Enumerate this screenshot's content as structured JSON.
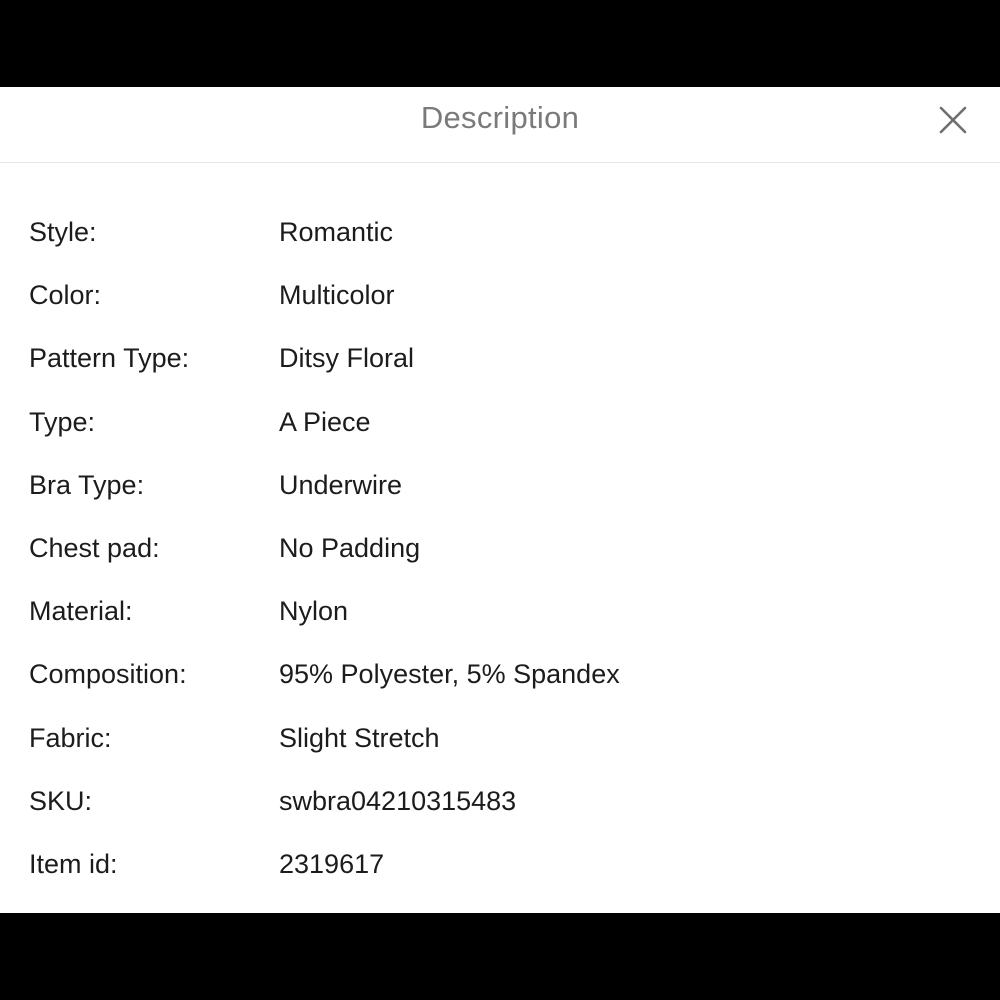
{
  "header": {
    "title": "Description",
    "close_icon": "close-icon"
  },
  "specs": [
    {
      "label": "Style:",
      "value": "Romantic"
    },
    {
      "label": "Color:",
      "value": "Multicolor"
    },
    {
      "label": "Pattern Type:",
      "value": "Ditsy Floral"
    },
    {
      "label": "Type:",
      "value": "A Piece"
    },
    {
      "label": "Bra Type:",
      "value": "Underwire"
    },
    {
      "label": "Chest pad:",
      "value": "No Padding"
    },
    {
      "label": "Material:",
      "value": "Nylon"
    },
    {
      "label": "Composition:",
      "value": "95% Polyester, 5% Spandex"
    },
    {
      "label": "Fabric:",
      "value": "Slight Stretch"
    },
    {
      "label": "SKU:",
      "value": "swbra04210315483"
    },
    {
      "label": "Item id:",
      "value": "2319617"
    }
  ],
  "colors": {
    "title_text": "#7a7a7a",
    "body_text": "#1c1c1c",
    "divider": "#e6e6e6",
    "close_icon": "#6f6f6f"
  }
}
